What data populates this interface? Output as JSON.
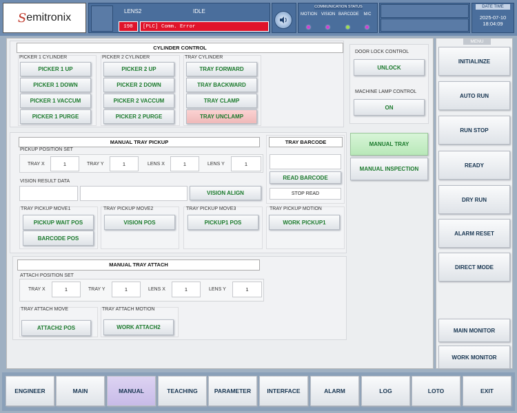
{
  "app": {
    "logo_s": "S",
    "logo_text": "emitronix"
  },
  "header": {
    "recipe": "LENS2",
    "state": "IDLE",
    "alarm_code": "198",
    "alarm_message": "[PLC] Comm. Error",
    "comm_status_label": "COMMUNICATION STATUS",
    "comm_items": [
      "MOTION",
      "VISION",
      "BARCODE",
      "M/C"
    ],
    "comm_colors": [
      "#d040d0",
      "#d040d0",
      "#9fe04a",
      "#d040d0"
    ],
    "date_time_label": "DATE TIME",
    "date": "2025-07-10",
    "time": "18:04:09",
    "speaker_icon": "speaker-icon"
  },
  "cylinder": {
    "title": "CYLINDER CONTROL",
    "picker1": {
      "label": "PICKER 1 CYLINDER",
      "buttons": [
        "PICKER 1 UP",
        "PICKER 1 DOWN",
        "PICKER 1 VACCUM",
        "PICKER 1 PURGE"
      ]
    },
    "picker2": {
      "label": "PICKER 2 CYLINDER",
      "buttons": [
        "PICKER 2 UP",
        "PICKER 2 DOWN",
        "PICKER 2 VACCUM",
        "PICKER 2 PURGE"
      ]
    },
    "tray": {
      "label": "TRAY CYLINDER",
      "buttons": [
        "TRAY FORWARD",
        "TRAY BACKWARD",
        "TRAY CLAMP",
        "TRAY UNCLAMP"
      ]
    }
  },
  "door_lock": {
    "label": "DOOR LOCK CONTROL",
    "button": "UNLOCK"
  },
  "machine_lamp": {
    "label": "MACHINE LAMP CONTROL",
    "button": "ON"
  },
  "mode": {
    "manual_tray": "MANUAL TRAY",
    "manual_inspection": "MANUAL INSPECTION"
  },
  "tray_pickup": {
    "title": "MANUAL TRAY PICKUP",
    "position_label": "PICKUP POSITION SET",
    "fields": [
      {
        "label": "TRAY X",
        "value": "1"
      },
      {
        "label": "TRAY Y",
        "value": "1"
      },
      {
        "label": "LENS X",
        "value": "1"
      },
      {
        "label": "LENS Y",
        "value": "1"
      }
    ],
    "vision_label": "VISION RESULT DATA",
    "vision_value_1": "",
    "vision_value_2": "",
    "vision_align": "VISION ALIGN",
    "move1_label": "TRAY PICKUP MOVE1",
    "move1_buttons": [
      "PICKUP WAIT POS",
      "BARCODE POS"
    ],
    "move2_label": "TRAY PICKUP MOVE2",
    "move2_button": "VISION POS",
    "move3_label": "TRAY PICKUP MOVE3",
    "move3_button": "PICKUP1 POS",
    "motion_label": "TRAY PICKUP MOTION",
    "motion_button": "WORK PICKUP1"
  },
  "barcode": {
    "title": "TRAY BARCODE",
    "value": "",
    "read": "READ BARCODE",
    "stop": "STOP READ"
  },
  "tray_attach": {
    "title": "MANUAL TRAY ATTACH",
    "position_label": "ATTACH POSITION SET",
    "fields": [
      {
        "label": "TRAY X",
        "value": "1"
      },
      {
        "label": "TRAY Y",
        "value": "1"
      },
      {
        "label": "LENS X",
        "value": "1"
      },
      {
        "label": "LENS Y",
        "value": "1"
      }
    ],
    "move_label": "TRAY ATTACH MOVE",
    "move_button": "ATTACH2 POS",
    "motion_label": "TRAY ATTACH MOTION",
    "motion_button": "WORK ATTACH2"
  },
  "menu": {
    "title": "MENU",
    "items": [
      "INITIALINZE",
      "AUTO RUN",
      "RUN STOP",
      "READY",
      "DRY RUN",
      "ALARM RESET",
      "DIRECT MODE"
    ],
    "monitors": [
      "MAIN MONITOR",
      "WORK MONITOR"
    ]
  },
  "nav": {
    "items": [
      "ENGINEER",
      "MAIN",
      "MANUAL",
      "TEACHING",
      "PARAMETER",
      "INTERFACE",
      "ALARM",
      "LOG",
      "LOTO",
      "EXIT"
    ],
    "active": "MANUAL"
  }
}
